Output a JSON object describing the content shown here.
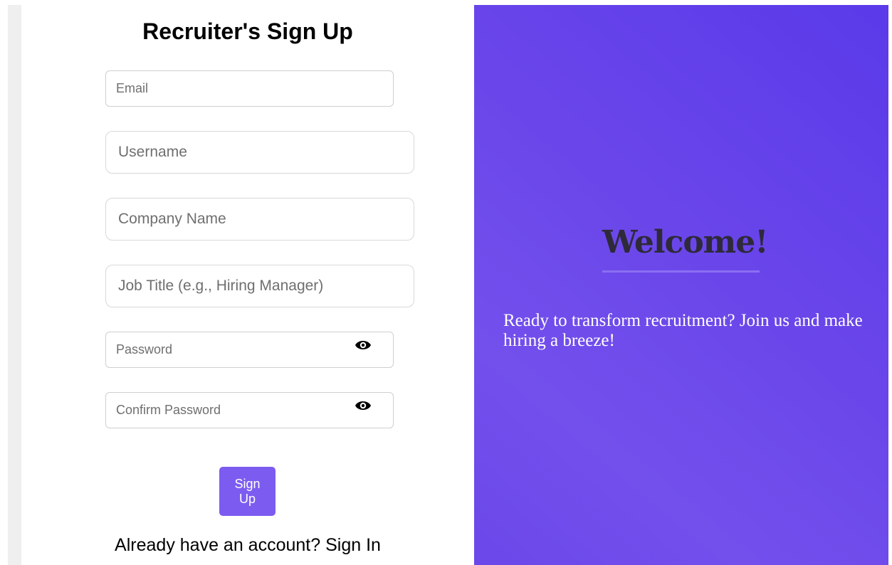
{
  "form": {
    "title": "Recruiter's Sign Up",
    "fields": {
      "email": {
        "placeholder": "Email",
        "value": ""
      },
      "username": {
        "placeholder": "Username",
        "value": ""
      },
      "company": {
        "placeholder": "Company Name",
        "value": ""
      },
      "job_title": {
        "placeholder": "Job Title (e.g., Hiring Manager)",
        "value": ""
      },
      "password": {
        "placeholder": "Password",
        "value": ""
      },
      "confirm_password": {
        "placeholder": "Confirm Password",
        "value": ""
      }
    },
    "icons": {
      "password_toggle": "eye-icon",
      "confirm_password_toggle": "eye-icon"
    },
    "signup_label": "Sign Up",
    "signin_prompt": "Already have an account?",
    "signin_label": "Sign In"
  },
  "welcome": {
    "title": "Welcome!",
    "message": "Ready to transform recruitment? Join us and make hiring a breeze!"
  },
  "colors": {
    "accent": "#7c5cf0",
    "panel_gradient_start": "#5a3ae9",
    "panel_gradient_end": "#7350ec",
    "welcome_title": "#2e2a3a"
  }
}
